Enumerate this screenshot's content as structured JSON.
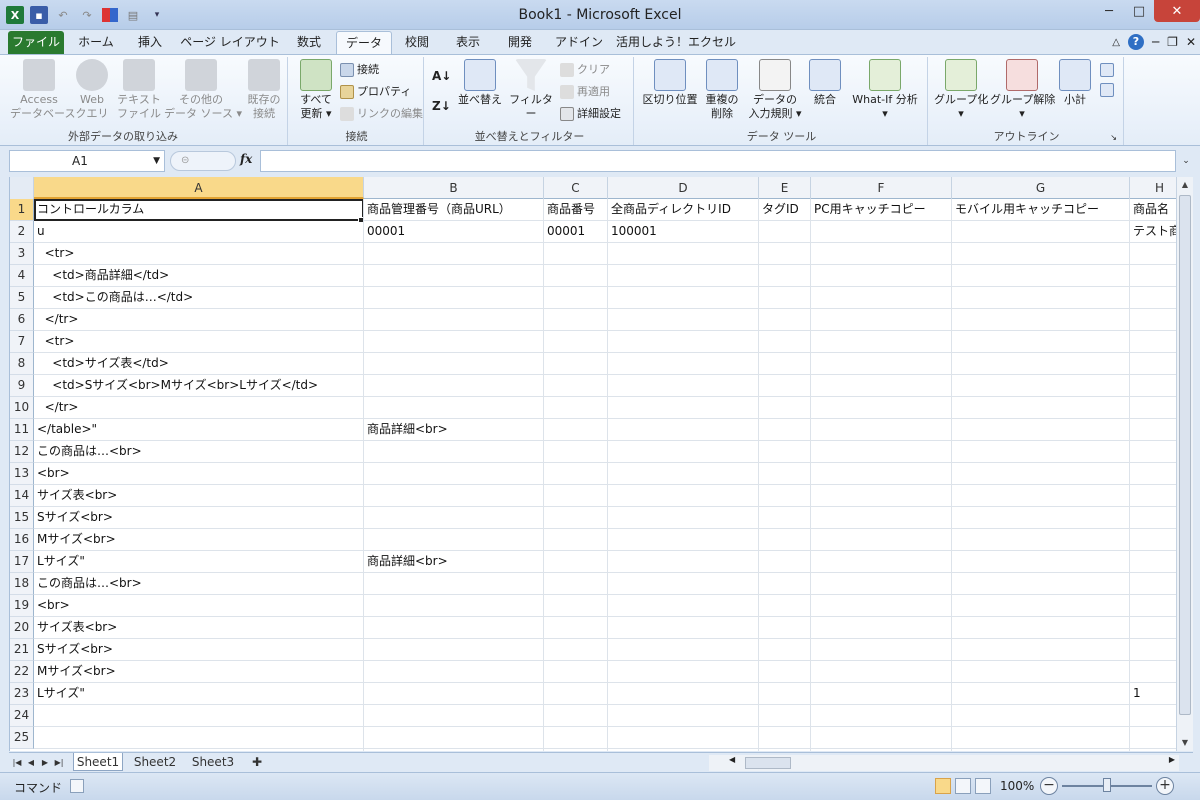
{
  "window": {
    "title": "Book1 - Microsoft Excel"
  },
  "tabs": [
    {
      "label": "ファイル"
    },
    {
      "label": "ホーム"
    },
    {
      "label": "挿入"
    },
    {
      "label": "ページ レイアウト"
    },
    {
      "label": "数式"
    },
    {
      "label": "データ"
    },
    {
      "label": "校閲"
    },
    {
      "label": "表示"
    },
    {
      "label": "開発"
    },
    {
      "label": "アドイン"
    },
    {
      "label": "活用しよう！エクセル"
    }
  ],
  "ribbon": {
    "external": {
      "label": "外部データの取り込み",
      "access": "Access\nデータベース",
      "web": "Web\nクエリ",
      "text": "テキスト\nファイル",
      "other": "その他の\nデータ ソース ▾",
      "existing": "既存の\n接続"
    },
    "connections": {
      "label": "接続",
      "refresh": "すべて\n更新 ▾",
      "connections": "接続",
      "properties": "プロパティ",
      "edit_links": "リンクの編集"
    },
    "sort": {
      "label": "並べ替えとフィルター",
      "sort": "並べ替え",
      "filter": "フィルター",
      "clear": "クリア",
      "reapply": "再適用",
      "advanced": "詳細設定"
    },
    "tools": {
      "label": "データ ツール",
      "text_to_columns": "区切り位置",
      "remove_dup": "重複の\n削除",
      "validation": "データの\n入力規則 ▾",
      "consolidate": "統合",
      "whatif": "What-If 分析\n▾"
    },
    "outline": {
      "label": "アウトライン",
      "group": "グループ化\n▾",
      "ungroup": "グループ解除\n▾",
      "subtotal": "小計"
    }
  },
  "formula_bar": {
    "name_box": "A1",
    "fx": "fx",
    "formula": ""
  },
  "grid": {
    "columns": [
      "A",
      "B",
      "C",
      "D",
      "E",
      "F",
      "G",
      "H"
    ],
    "rows": [
      {
        "n": "1",
        "A": "コントロールカラム",
        "B": "商品管理番号（商品URL）",
        "C": "商品番号",
        "D": "全商品ディレクトリID",
        "E": "タグID",
        "F": "PC用キャッチコピー",
        "G": "モバイル用キャッチコピー",
        "H": "商品名"
      },
      {
        "n": "2",
        "A": "u",
        "B": "00001",
        "C": "00001",
        "D": "100001",
        "E": "",
        "F": "",
        "G": "",
        "H": "テスト商"
      },
      {
        "n": "3",
        "A": "  <tr>",
        "B": "",
        "C": "",
        "D": "",
        "E": "",
        "F": "",
        "G": "",
        "H": ""
      },
      {
        "n": "4",
        "A": "    <td>商品詳細</td>",
        "B": "",
        "C": "",
        "D": "",
        "E": "",
        "F": "",
        "G": "",
        "H": ""
      },
      {
        "n": "5",
        "A": "    <td>この商品は…</td>",
        "B": "",
        "C": "",
        "D": "",
        "E": "",
        "F": "",
        "G": "",
        "H": ""
      },
      {
        "n": "6",
        "A": "  </tr>",
        "B": "",
        "C": "",
        "D": "",
        "E": "",
        "F": "",
        "G": "",
        "H": ""
      },
      {
        "n": "7",
        "A": "  <tr>",
        "B": "",
        "C": "",
        "D": "",
        "E": "",
        "F": "",
        "G": "",
        "H": ""
      },
      {
        "n": "8",
        "A": "    <td>サイズ表</td>",
        "B": "",
        "C": "",
        "D": "",
        "E": "",
        "F": "",
        "G": "",
        "H": ""
      },
      {
        "n": "9",
        "A": "    <td>Sサイズ<br>Mサイズ<br>Lサイズ</td>",
        "B": "",
        "C": "",
        "D": "",
        "E": "",
        "F": "",
        "G": "",
        "H": ""
      },
      {
        "n": "10",
        "A": "  </tr>",
        "B": "",
        "C": "",
        "D": "",
        "E": "",
        "F": "",
        "G": "",
        "H": ""
      },
      {
        "n": "11",
        "A": "</table>\"",
        "B": "商品詳細<br>",
        "C": "",
        "D": "",
        "E": "",
        "F": "",
        "G": "",
        "H": ""
      },
      {
        "n": "12",
        "A": "この商品は…<br>",
        "B": "",
        "C": "",
        "D": "",
        "E": "",
        "F": "",
        "G": "",
        "H": ""
      },
      {
        "n": "13",
        "A": "<br>",
        "B": "",
        "C": "",
        "D": "",
        "E": "",
        "F": "",
        "G": "",
        "H": ""
      },
      {
        "n": "14",
        "A": "サイズ表<br>",
        "B": "",
        "C": "",
        "D": "",
        "E": "",
        "F": "",
        "G": "",
        "H": ""
      },
      {
        "n": "15",
        "A": "Sサイズ<br>",
        "B": "",
        "C": "",
        "D": "",
        "E": "",
        "F": "",
        "G": "",
        "H": ""
      },
      {
        "n": "16",
        "A": "Mサイズ<br>",
        "B": "",
        "C": "",
        "D": "",
        "E": "",
        "F": "",
        "G": "",
        "H": ""
      },
      {
        "n": "17",
        "A": "Lサイズ\"",
        "B": "商品詳細<br>",
        "C": "",
        "D": "",
        "E": "",
        "F": "",
        "G": "",
        "H": ""
      },
      {
        "n": "18",
        "A": "この商品は…<br>",
        "B": "",
        "C": "",
        "D": "",
        "E": "",
        "F": "",
        "G": "",
        "H": ""
      },
      {
        "n": "19",
        "A": "<br>",
        "B": "",
        "C": "",
        "D": "",
        "E": "",
        "F": "",
        "G": "",
        "H": ""
      },
      {
        "n": "20",
        "A": "サイズ表<br>",
        "B": "",
        "C": "",
        "D": "",
        "E": "",
        "F": "",
        "G": "",
        "H": ""
      },
      {
        "n": "21",
        "A": "Sサイズ<br>",
        "B": "",
        "C": "",
        "D": "",
        "E": "",
        "F": "",
        "G": "",
        "H": ""
      },
      {
        "n": "22",
        "A": "Mサイズ<br>",
        "B": "",
        "C": "",
        "D": "",
        "E": "",
        "F": "",
        "G": "",
        "H": ""
      },
      {
        "n": "23",
        "A": "Lサイズ\"",
        "B": "",
        "C": "",
        "D": "",
        "E": "",
        "F": "",
        "G": "",
        "H": "1"
      },
      {
        "n": "24",
        "A": "",
        "B": "",
        "C": "",
        "D": "",
        "E": "",
        "F": "",
        "G": "",
        "H": ""
      },
      {
        "n": "25",
        "A": "",
        "B": "",
        "C": "",
        "D": "",
        "E": "",
        "F": "",
        "G": "",
        "H": ""
      }
    ]
  },
  "sheets": [
    {
      "label": "Sheet1"
    },
    {
      "label": "Sheet2"
    },
    {
      "label": "Sheet3"
    }
  ],
  "status": {
    "mode": "コマンド",
    "zoom": "100%"
  },
  "colors": {
    "file_tab": "#2a7a2f",
    "close_button": "#c7443a",
    "selection": "#f9d98a"
  }
}
